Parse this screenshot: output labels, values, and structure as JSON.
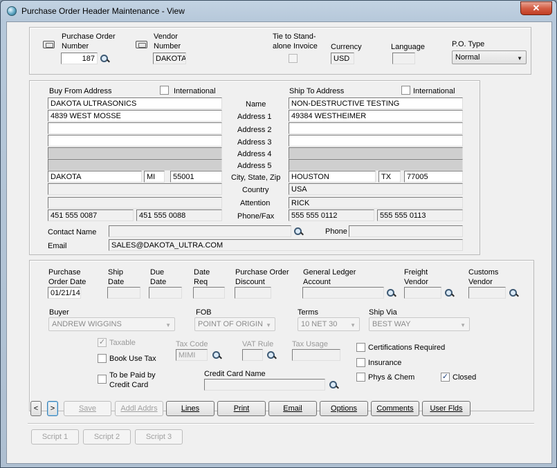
{
  "window": {
    "title": "Purchase Order Header Maintenance - View",
    "close_glyph": "✕"
  },
  "header": {
    "po_number_label": "Purchase Order\nNumber",
    "po_number": "187",
    "vendor_number_label": "Vendor\nNumber",
    "vendor_number": "DAKOTA",
    "tie_label": "Tie to Stand-\nalone Invoice",
    "currency_label": "Currency",
    "currency": "USD",
    "language_label": "Language",
    "language": "",
    "po_type_label": "P.O. Type",
    "po_type": "Normal"
  },
  "address": {
    "buy_from_label": "Buy From Address",
    "ship_to_label": "Ship To Address",
    "international_label": "International",
    "row_labels": [
      "Name",
      "Address 1",
      "Address 2",
      "Address 3",
      "Address 4",
      "Address 5",
      "City, State, Zip",
      "Country",
      "Attention",
      "Phone/Fax"
    ],
    "buy_from": {
      "name": "DAKOTA ULTRASONICS",
      "address1": "4839 WEST MOSSE",
      "address2": "",
      "address3": "",
      "address4": "",
      "address5": "",
      "city": "DAKOTA",
      "state": "MI",
      "zip": "55001",
      "country": "",
      "attention": "",
      "phone": "451  555  0087",
      "fax": "451  555  0088"
    },
    "ship_to": {
      "name": "NON-DESTRUCTIVE TESTING",
      "address1": "49384 WESTHEIMER",
      "address2": "",
      "address3": "",
      "address4": "",
      "address5": "",
      "city": "HOUSTON",
      "state": "TX",
      "zip": "77005",
      "country": "USA",
      "attention": "RICK",
      "phone": "555  555  0112",
      "fax": "555  555  0113"
    },
    "contact_name_label": "Contact Name",
    "contact_name": "",
    "phone_label": "Phone",
    "phone": "",
    "email_label": "Email",
    "email": "SALES@DAKOTA_ULTRA.COM"
  },
  "details": {
    "po_date_label": "Purchase\nOrder Date",
    "po_date": "01/21/14",
    "ship_date_label": "Ship\nDate",
    "due_date_label": "Due\nDate",
    "date_req_label": "Date\nReq",
    "discount_label": "Purchase Order\nDiscount",
    "gl_label": "General Ledger\nAccount",
    "freight_label": "Freight\nVendor",
    "customs_label": "Customs\nVendor",
    "buyer_label": "Buyer",
    "buyer": "ANDREW WIGGINS",
    "fob_label": "FOB",
    "fob": "POINT OF ORIGIN",
    "terms_label": "Terms",
    "terms": "10 NET 30",
    "ship_via_label": "Ship Via",
    "ship_via": "BEST WAY",
    "taxable_label": "Taxable",
    "book_use_tax_label": "Book Use Tax",
    "paid_by_cc_label": "To be Paid by\nCredit Card",
    "tax_code_label": "Tax Code",
    "tax_code": "MIMI",
    "vat_rule_label": "VAT Rule",
    "tax_usage_label": "Tax Usage",
    "credit_card_label": "Credit Card Name",
    "certifications_label": "Certifications Required",
    "insurance_label": "Insurance",
    "phys_chem_label": "Phys & Chem",
    "closed_label": "Closed",
    "check_glyph": "✓"
  },
  "toolbar": {
    "prev": "<",
    "next": ">",
    "save": "Save",
    "addl_addrs": "Addl Addrs",
    "lines": "Lines",
    "print": "Print",
    "email": "Email",
    "options": "Options",
    "comments": "Comments",
    "user_flds": "User Flds"
  },
  "scripts": {
    "script1": "Script 1",
    "script2": "Script 2",
    "script3": "Script 3"
  }
}
